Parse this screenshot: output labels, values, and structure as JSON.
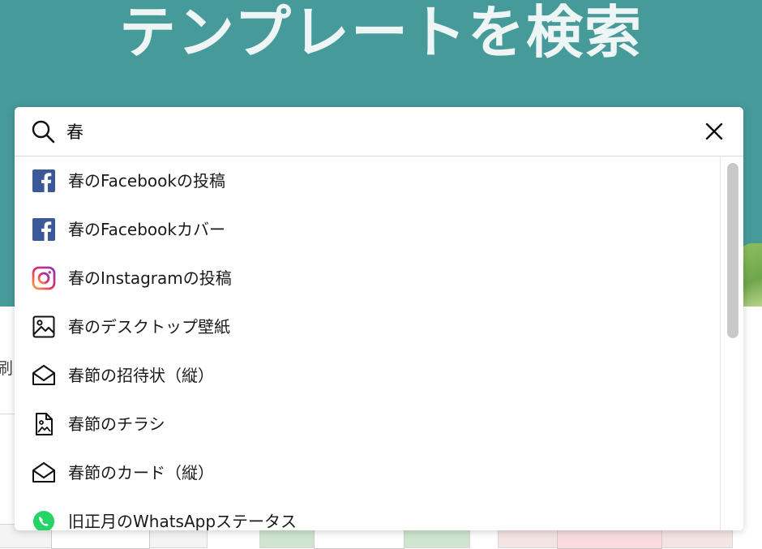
{
  "hero": {
    "title": "テンプレートを検索"
  },
  "side": {
    "text": "刷"
  },
  "search": {
    "value": "春",
    "placeholder": ""
  },
  "suggestions": [
    {
      "label": "春のFacebookの投稿",
      "icon": "facebook-icon"
    },
    {
      "label": "春のFacebookカバー",
      "icon": "facebook-icon"
    },
    {
      "label": "春のInstagramの投稿",
      "icon": "instagram-icon"
    },
    {
      "label": "春のデスクトップ壁紙",
      "icon": "image-icon"
    },
    {
      "label": "春節の招待状（縦）",
      "icon": "envelope-icon"
    },
    {
      "label": "春節のチラシ",
      "icon": "flyer-icon"
    },
    {
      "label": "春節のカード（縦）",
      "icon": "envelope-icon"
    },
    {
      "label": "旧正月のWhatsAppステータス",
      "icon": "whatsapp-icon"
    }
  ],
  "colors": {
    "hero_bg": "#479a9a",
    "facebook": "#3b5998",
    "whatsapp": "#25d366"
  }
}
